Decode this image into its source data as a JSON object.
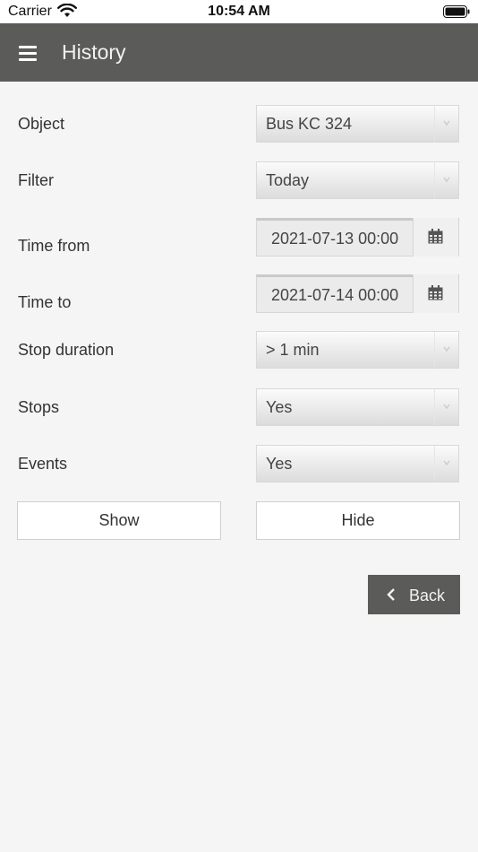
{
  "status_bar": {
    "carrier": "Carrier",
    "time": "10:54 AM"
  },
  "header": {
    "title": "History"
  },
  "form": {
    "object": {
      "label": "Object",
      "value": "Bus KC 324"
    },
    "filter": {
      "label": "Filter",
      "value": "Today"
    },
    "time_from": {
      "label": "Time from",
      "value": "2021-07-13 00:00"
    },
    "time_to": {
      "label": "Time to",
      "value": "2021-07-14 00:00"
    },
    "stop_duration": {
      "label": "Stop duration",
      "value": "> 1 min"
    },
    "stops": {
      "label": "Stops",
      "value": "Yes"
    },
    "events": {
      "label": "Events",
      "value": "Yes"
    }
  },
  "actions": {
    "show_label": "Show",
    "hide_label": "Hide",
    "back_label": "Back"
  },
  "colors": {
    "header_bg": "#5b5c5a",
    "page_bg": "#f5f5f5"
  }
}
